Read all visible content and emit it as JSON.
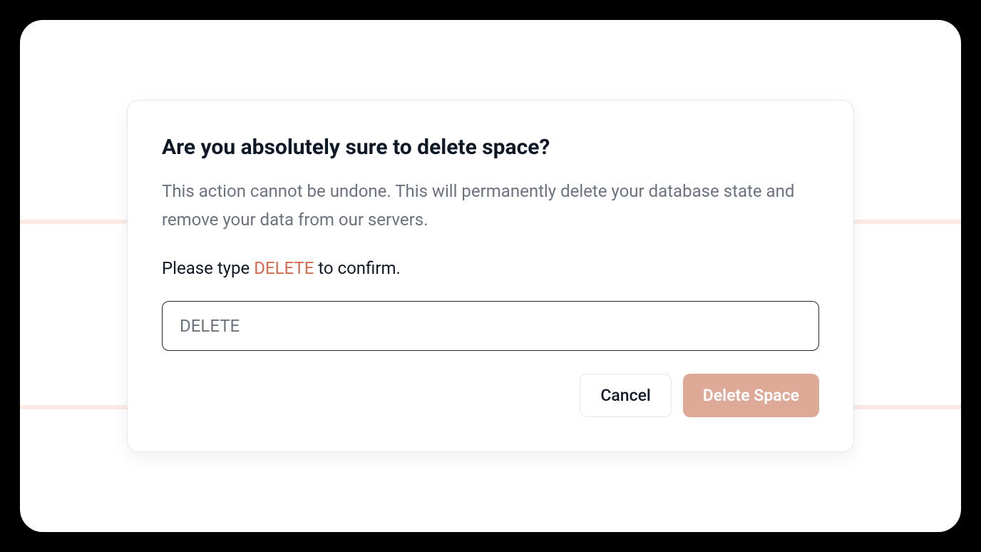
{
  "dialog": {
    "title": "Are you absolutely sure to delete space?",
    "description": "This action cannot be undone. This will permanently delete your database state and remove your data from our servers.",
    "prompt_prefix": "Please type ",
    "prompt_keyword": "DELETE",
    "prompt_suffix": " to confirm.",
    "input_placeholder": "DELETE",
    "input_value": "",
    "cancel_label": "Cancel",
    "delete_label": "Delete Space"
  },
  "colors": {
    "accent": "#d96a4e",
    "danger_button": "#dfa998",
    "text_primary": "#0f1826",
    "text_muted": "#6b7280"
  }
}
